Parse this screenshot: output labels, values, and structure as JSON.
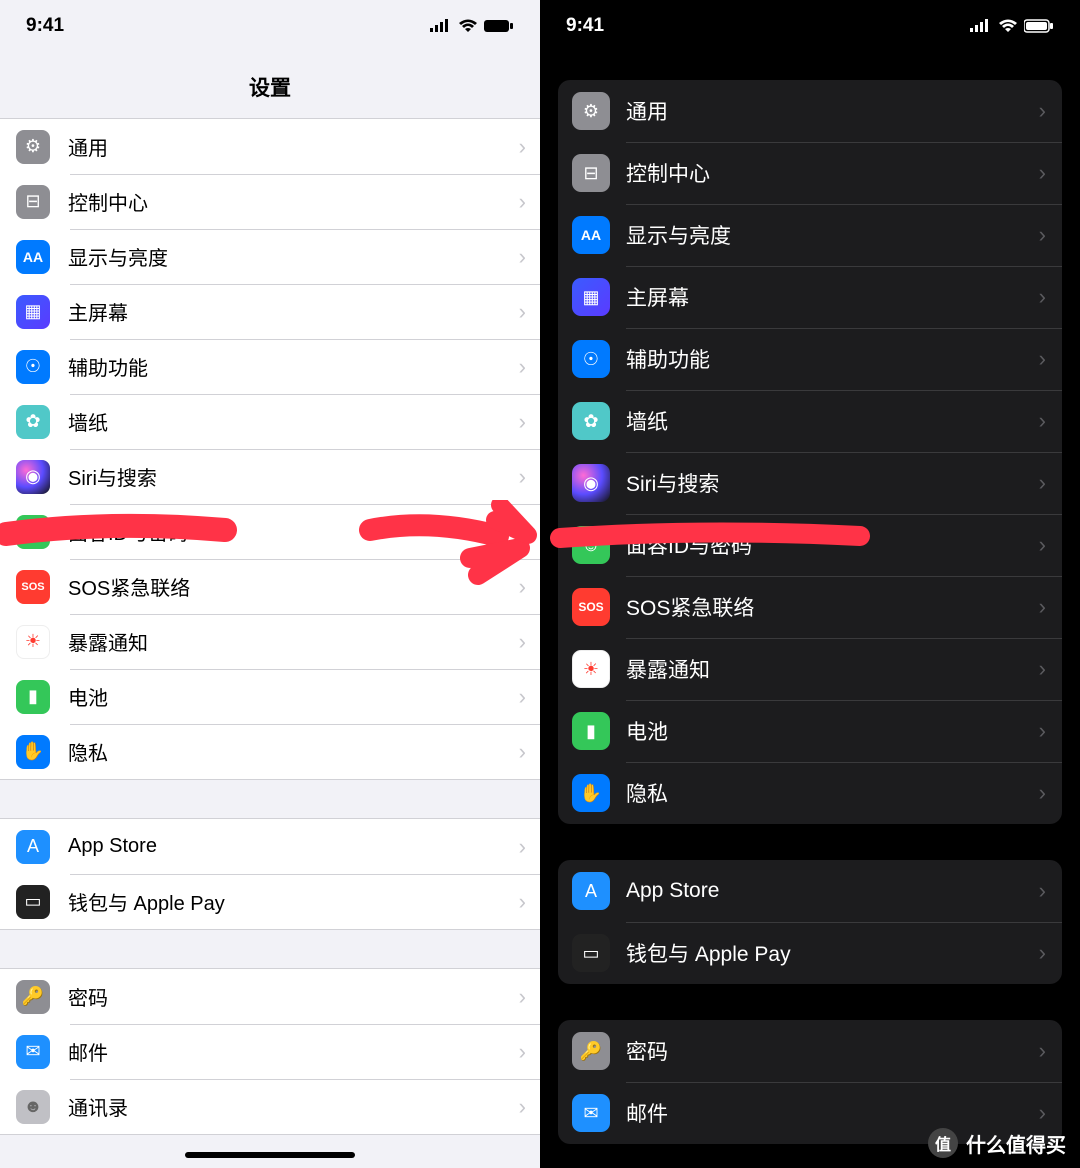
{
  "status_time": "9:41",
  "page_title": "设置",
  "groups": [
    {
      "items": [
        {
          "key": "general",
          "label": "通用",
          "iconClass": "ic-general",
          "glyph": "⚙"
        },
        {
          "key": "control",
          "label": "控制中心",
          "iconClass": "ic-control",
          "glyph": "⊟"
        },
        {
          "key": "display",
          "label": "显示与亮度",
          "iconClass": "ic-display",
          "glyph": "AA"
        },
        {
          "key": "home",
          "label": "主屏幕",
          "iconClass": "ic-home",
          "glyph": "▦"
        },
        {
          "key": "access",
          "label": "辅助功能",
          "iconClass": "ic-access",
          "glyph": "☉"
        },
        {
          "key": "wallpaper",
          "label": "墙纸",
          "iconClass": "ic-wallpaper",
          "glyph": "✿"
        },
        {
          "key": "siri",
          "label": "Siri与搜索",
          "iconClass": "ic-siri",
          "glyph": "◉"
        },
        {
          "key": "faceid",
          "label": "面容ID与密码",
          "iconClass": "ic-faceid",
          "glyph": "☺"
        },
        {
          "key": "sos",
          "label": "SOS紧急联络",
          "iconClass": "ic-sos",
          "glyph": "SOS"
        },
        {
          "key": "exposure",
          "label": "暴露通知",
          "iconClass": "ic-exposure",
          "glyph": "☀"
        },
        {
          "key": "battery",
          "label": "电池",
          "iconClass": "ic-battery",
          "glyph": "▮"
        },
        {
          "key": "privacy",
          "label": "隐私",
          "iconClass": "ic-privacy",
          "glyph": "✋"
        }
      ]
    },
    {
      "items": [
        {
          "key": "appstore",
          "label": "App Store",
          "iconClass": "ic-appstore",
          "glyph": "A"
        },
        {
          "key": "wallet",
          "label": "钱包与 Apple Pay",
          "iconClass": "ic-wallet",
          "glyph": "▭"
        }
      ]
    },
    {
      "items": [
        {
          "key": "passwords",
          "label": "密码",
          "iconClass": "ic-passwords",
          "glyph": "🔑"
        },
        {
          "key": "mail",
          "label": "邮件",
          "iconClass": "ic-mail",
          "glyph": "✉"
        },
        {
          "key": "contacts",
          "label": "通讯录",
          "iconClass": "ic-contacts",
          "glyph": "☻"
        }
      ]
    }
  ],
  "dark_groups": [
    {
      "items": [
        {
          "key": "general",
          "label": "通用",
          "iconClass": "ic-general",
          "glyph": "⚙",
          "partial": true
        },
        {
          "key": "control",
          "label": "控制中心",
          "iconClass": "ic-control",
          "glyph": "⊟"
        },
        {
          "key": "display",
          "label": "显示与亮度",
          "iconClass": "ic-display",
          "glyph": "AA"
        },
        {
          "key": "home",
          "label": "主屏幕",
          "iconClass": "ic-home",
          "glyph": "▦"
        },
        {
          "key": "access",
          "label": "辅助功能",
          "iconClass": "ic-access",
          "glyph": "☉"
        },
        {
          "key": "wallpaper",
          "label": "墙纸",
          "iconClass": "ic-wallpaper",
          "glyph": "✿"
        },
        {
          "key": "siri",
          "label": "Siri与搜索",
          "iconClass": "ic-siri",
          "glyph": "◉"
        },
        {
          "key": "faceid",
          "label": "面容ID与密码",
          "iconClass": "ic-faceid",
          "glyph": "☺"
        },
        {
          "key": "sos",
          "label": "SOS紧急联络",
          "iconClass": "ic-sos",
          "glyph": "SOS"
        },
        {
          "key": "exposure",
          "label": "暴露通知",
          "iconClass": "ic-exposure",
          "glyph": "☀"
        },
        {
          "key": "battery",
          "label": "电池",
          "iconClass": "ic-battery",
          "glyph": "▮"
        },
        {
          "key": "privacy",
          "label": "隐私",
          "iconClass": "ic-privacy",
          "glyph": "✋"
        }
      ]
    },
    {
      "items": [
        {
          "key": "appstore",
          "label": "App Store",
          "iconClass": "ic-appstore",
          "glyph": "A"
        },
        {
          "key": "wallet",
          "label": "钱包与 Apple Pay",
          "iconClass": "ic-wallet",
          "glyph": "▭"
        }
      ]
    },
    {
      "items": [
        {
          "key": "passwords",
          "label": "密码",
          "iconClass": "ic-passwords",
          "glyph": "🔑"
        },
        {
          "key": "mail",
          "label": "邮件",
          "iconClass": "ic-mail",
          "glyph": "✉"
        }
      ]
    }
  ],
  "watermark": {
    "badge": "值",
    "text": "什么值得买"
  },
  "annotation_color": "#ff3347"
}
